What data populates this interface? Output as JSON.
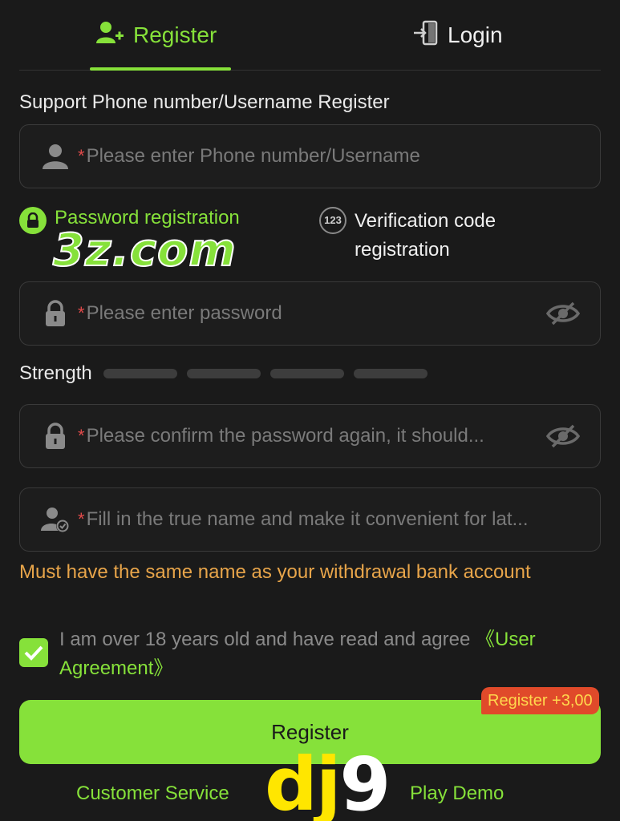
{
  "tabs": {
    "register_label": "Register",
    "login_label": "Login"
  },
  "section_title": "Support Phone number/Username Register",
  "username_field": {
    "required_mark": "*",
    "placeholder": "Please enter Phone number/Username"
  },
  "modes": {
    "password_label": "Password registration",
    "code_label": "Verification code registration",
    "code_icon_text": "123"
  },
  "password_field": {
    "required_mark": "*",
    "placeholder": "Please enter password"
  },
  "strength": {
    "label": "Strength",
    "level": 0,
    "segments": 4
  },
  "confirm_field": {
    "required_mark": "*",
    "placeholder": "Please confirm the password again, it should..."
  },
  "realname_field": {
    "required_mark": "*",
    "placeholder": "Fill in the true name and make it convenient for lat..."
  },
  "bank_note": "Must have the same name as your withdrawal bank account",
  "agreement": {
    "checked": true,
    "text": "I am over 18 years old and have read and agree ",
    "link": "《User Agreement》"
  },
  "register_button": "Register",
  "bonus_badge": "Register +3,00",
  "footer": {
    "customer_service": "Customer Service",
    "play_demo": "Play Demo"
  },
  "watermarks": {
    "top": "3z.com",
    "bottom_part1": "dj",
    "bottom_part2": "9"
  },
  "colors": {
    "accent": "#86e13a",
    "background": "#1a1a1a",
    "warning": "#e8a54a",
    "required": "#e24a4a",
    "badge": "#e04a2a"
  }
}
